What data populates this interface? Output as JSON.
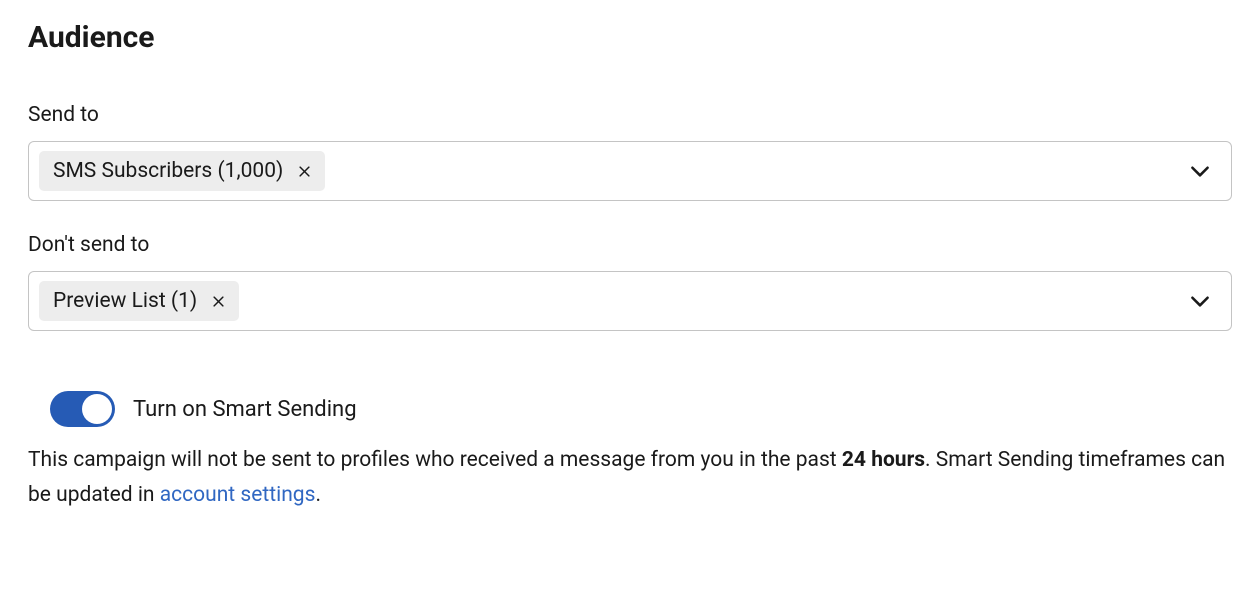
{
  "section": {
    "title": "Audience"
  },
  "send_to": {
    "label": "Send to",
    "chip": "SMS Subscribers (1,000)"
  },
  "dont_send_to": {
    "label": "Don't send to",
    "chip": "Preview List (1)"
  },
  "smart_sending": {
    "toggle_label": "Turn on Smart Sending",
    "desc_part1": "This campaign will not be sent to profiles who received a message from you in the past ",
    "desc_bold": "24 hours",
    "desc_part2": ". Smart Sending timeframes can be updated in ",
    "desc_link": "account settings",
    "desc_part3": "."
  }
}
